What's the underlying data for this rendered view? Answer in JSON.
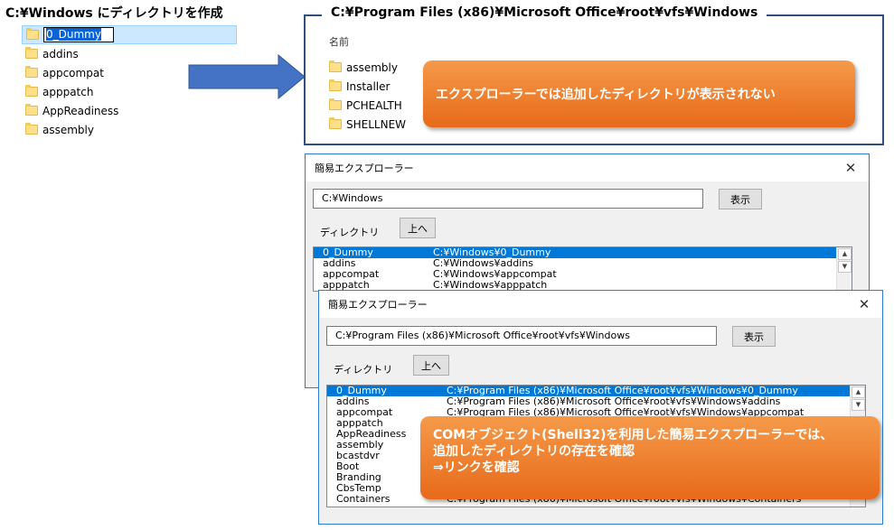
{
  "left_panel": {
    "title": "C:¥Windows にディレクトリを作成",
    "rename_value": "0_Dummy",
    "items": [
      "addins",
      "appcompat",
      "apppatch",
      "AppReadiness",
      "assembly"
    ]
  },
  "explorer_box": {
    "title": "C:¥Program Files (x86)¥Microsoft Office¥root¥vfs¥Windows",
    "column_header": "名前",
    "items": [
      "assembly",
      "Installer",
      "PCHEALTH",
      "SHELLNEW"
    ]
  },
  "callout_top": "エクスプローラーでは追加したディレクトリが表示されない",
  "callout_bottom": {
    "line1": "COMオブジェクト(Shell32)を利用した簡易エクスプローラーでは、",
    "line2": "追加したディレクトリの存在を確認",
    "line3": "⇒リンクを確認"
  },
  "dialog1": {
    "title": "簡易エクスプローラー",
    "path": "C:¥Windows",
    "show_button": "表示",
    "dir_label": "ディレクトリ",
    "up_button": "上へ",
    "rows": [
      {
        "name": "0_Dummy",
        "path": "C:¥Windows¥0_Dummy"
      },
      {
        "name": "addins",
        "path": "C:¥Windows¥addins"
      },
      {
        "name": "appcompat",
        "path": "C:¥Windows¥appcompat"
      },
      {
        "name": "apppatch",
        "path": "C:¥Windows¥apppatch"
      }
    ]
  },
  "dialog2": {
    "title": "簡易エクスプローラー",
    "path": "C:¥Program Files (x86)¥Microsoft Office¥root¥vfs¥Windows",
    "show_button": "表示",
    "dir_label": "ディレクトリ",
    "up_button": "上へ",
    "rows": [
      {
        "name": "0_Dummy",
        "path": "C:¥Program Files (x86)¥Microsoft Office¥root¥vfs¥Windows¥0_Dummy"
      },
      {
        "name": "addins",
        "path": "C:¥Program Files (x86)¥Microsoft Office¥root¥vfs¥Windows¥addins"
      },
      {
        "name": "appcompat",
        "path": "C:¥Program Files (x86)¥Microsoft Office¥root¥vfs¥Windows¥appcompat"
      },
      {
        "name": "apppatch",
        "path": ""
      },
      {
        "name": "AppReadiness",
        "path": ""
      },
      {
        "name": "assembly",
        "path": ""
      },
      {
        "name": "bcastdvr",
        "path": ""
      },
      {
        "name": "Boot",
        "path": ""
      },
      {
        "name": "Branding",
        "path": ""
      },
      {
        "name": "CbsTemp",
        "path": ""
      },
      {
        "name": "Containers",
        "path": "C:¥Program Files (x86)¥Microsoft Office¥root¥vfs¥Windows¥Containers"
      }
    ]
  },
  "icons": {
    "folder": "folder-icon",
    "close": "close-icon",
    "arrow": "right-arrow-icon",
    "scroll_up": "scroll-up-icon",
    "scroll_down": "scroll-down-icon"
  },
  "colors": {
    "callout": "#e76a1a",
    "arrow": "#4472c4",
    "box_border": "#2f4f7f",
    "selection": "#0078d7"
  }
}
